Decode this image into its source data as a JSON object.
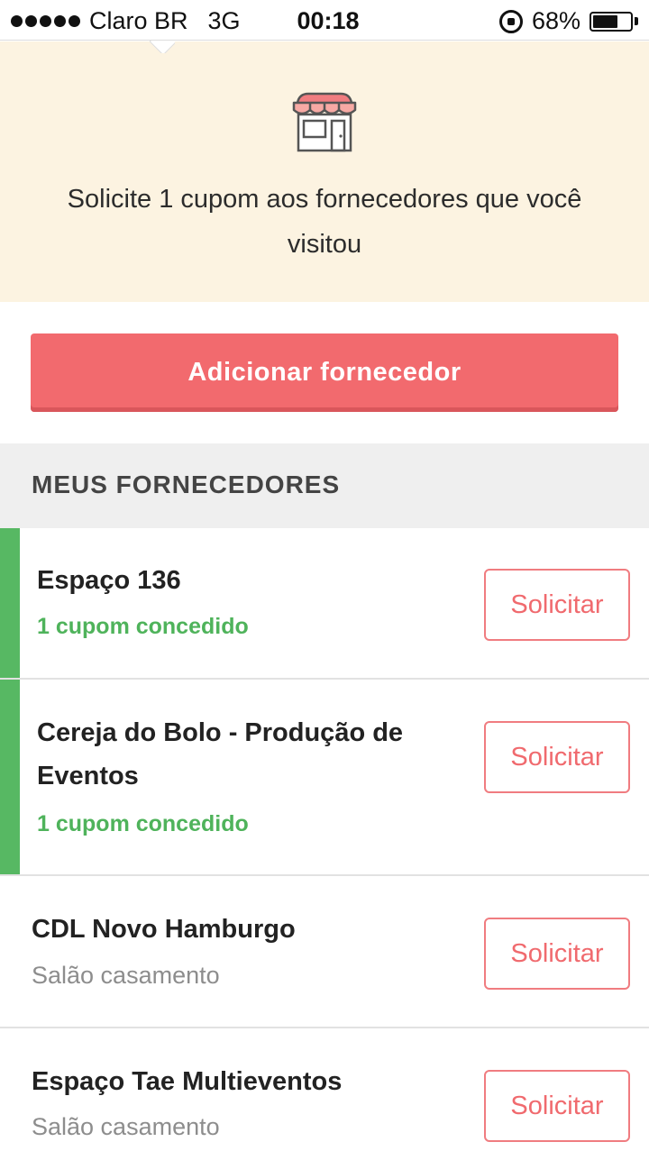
{
  "status_bar": {
    "carrier": "Claro BR",
    "network": "3G",
    "time": "00:18",
    "battery_percent": "68%",
    "battery_level": 0.68
  },
  "banner": {
    "icon": "store-icon",
    "text": "Solicite 1 cupom aos fornecedores que você visitou"
  },
  "add_button": {
    "label": "Adicionar fornecedor"
  },
  "section": {
    "title": "MEUS FORNECEDORES"
  },
  "suppliers": [
    {
      "name": "Espaço 136",
      "status": "1 cupom concedido",
      "button": "Solicitar",
      "granted": true
    },
    {
      "name": "Cereja do Bolo - Produção de Eventos",
      "status": "1 cupom concedido",
      "button": "Solicitar",
      "granted": true
    },
    {
      "name": "CDL Novo Hamburgo",
      "status": "Salão casamento",
      "button": "Solicitar",
      "granted": false
    },
    {
      "name": "Espaço Tae Multieventos",
      "status": "Salão casamento",
      "button": "Solicitar",
      "granted": false
    }
  ],
  "colors": {
    "accent_red": "#f26a6e",
    "granted_green": "#57b863",
    "banner_bg": "#fcf3e1"
  }
}
